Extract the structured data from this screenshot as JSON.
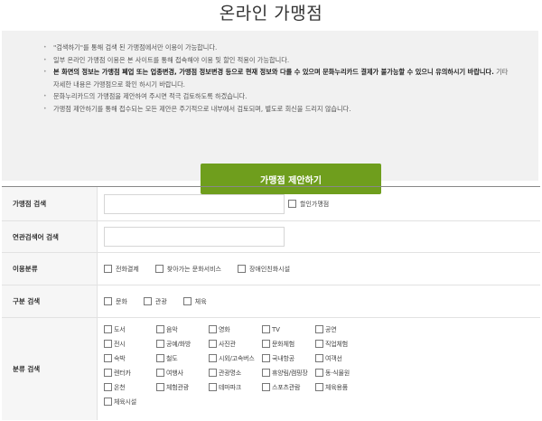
{
  "page": {
    "title": "온라인 가맹점"
  },
  "notice": {
    "items": [
      {
        "plain": "\"검색하기\"를 통해 검색 된 가맹점에서만 이용이 가능합니다.",
        "bold": ""
      },
      {
        "plain": "일부 온라인 가맹점 이용은 본 사이트를 통해 접속해야 이용 및 할인 적용이 가능합니다.",
        "bold": ""
      },
      {
        "bold": "본 화면의 정보는 가맹점 폐업 또는 업종변경, 가맹점 정보변경 등으로 현재 정보와 다를 수 있으며 문화누리카드 결제가 불가능할 수 있으니 유의하시기 바랍니다.",
        "plain": " 기타 자세한 내용은 가맹점으로 확인 하시기 바랍니다."
      },
      {
        "plain": "문화누리카드의 가맹점을 제안하여 주시면 적극 검토하도록 하겠습니다.",
        "bold": ""
      },
      {
        "plain": "가맹점 제안하기를 통해 접수되는 모든 제안은 주기적으로 내부에서 검토되며, 별도로 회신을 드리지 않습니다.",
        "bold": ""
      }
    ],
    "button_label": "가맹점 제안하기"
  },
  "form": {
    "merchant_search": {
      "label": "가맹점 검색",
      "value": "",
      "discount_label": "할인가맹점"
    },
    "related_search": {
      "label": "연관검색어 검색",
      "value": ""
    },
    "usage": {
      "label": "이용분류",
      "options": [
        "전화결제",
        "찾아가는 문화서비스",
        "장애인친화시설"
      ]
    },
    "division": {
      "label": "구분 검색",
      "options": [
        "문화",
        "관광",
        "체육"
      ]
    },
    "category": {
      "label": "분류 검색",
      "options": [
        "도서",
        "음악",
        "영화",
        "TV",
        "공연",
        "전시",
        "공예/화방",
        "사진관",
        "문화체험",
        "직업체험",
        "숙박",
        "철도",
        "시외/고속버스",
        "국내항공",
        "여객선",
        "렌터카",
        "여행사",
        "관광명소",
        "휴양림/캠핑장",
        "동·식물원",
        "온천",
        "체험관광",
        "테마파크",
        "스포츠관람",
        "체육용품",
        "체육시설"
      ]
    }
  }
}
